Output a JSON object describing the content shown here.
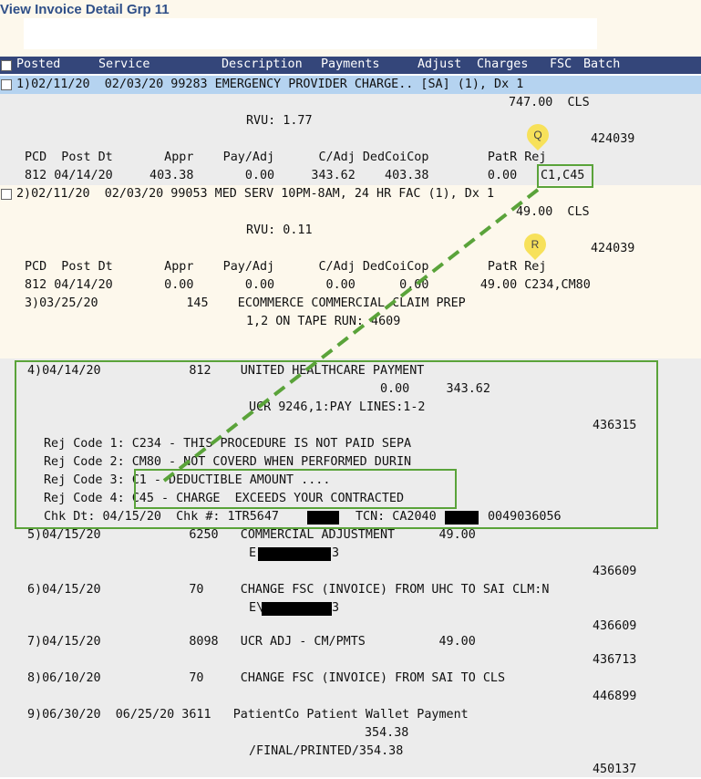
{
  "page": {
    "title": "View Invoice Detail Grp 11"
  },
  "header": {
    "posted": "Posted",
    "service": "Service",
    "description": "Description",
    "payments": "Payments",
    "adjust": "Adjust",
    "charges": "Charges",
    "fsc": "FSC",
    "batch": "Batch"
  },
  "rows": {
    "r1": {
      "line": "1)02/11/20  02/03/20 99283 EMERGENCY PROVIDER CHARGE.. [SA] (1), Dx 1",
      "charge": "747.00  CLS",
      "rvu": "RVU: 1.77",
      "batch": "424039",
      "sub_hdr": "PCD  Post Dt       Appr    Pay/Adj      C/Adj DedCoiCop        PatR Rej",
      "sub_line": "812 04/14/20     403.38       0.00     343.62    403.38        0.00 ",
      "rej": "C1,C45"
    },
    "r2": {
      "line": "2)02/11/20  02/03/20 99053 MED SERV 10PM-8AM, 24 HR FAC (1), Dx 1",
      "charge": "49.00  CLS",
      "rvu": "RVU: 0.11",
      "batch": "424039",
      "sub_hdr": "PCD  Post Dt       Appr    Pay/Adj      C/Adj DedCoiCop        PatR Rej",
      "sub_line": "812 04/14/20       0.00       0.00       0.00      0.00       49.00 C234,CM80"
    },
    "r3": {
      "line": "3)03/25/20            145    ECOMMERCE COMMERCIAL CLAIM PREP",
      "sub": "1,2 ON TAPE RUN: 4609"
    },
    "r4": {
      "line": "4)04/14/20            812    UNITED HEALTHCARE PAYMENT",
      "amounts": "0.00     343.62",
      "ucr": "UCR 9246,1:PAY LINES:1-2",
      "batch": "436315",
      "rej1": "Rej Code 1: C234 - THIS PROCEDURE IS NOT PAID SEPA",
      "rej2": "Rej Code 2: CM80 - NOT COVERD WHEN PERFORMED DURIN",
      "rej3": "Rej Code 3: C1 - DEDUCTIBLE AMOUNT ....",
      "rej4": "Rej Code 4: C45 - CHARGE  EXCEEDS YOUR CONTRACTED",
      "chk_a": "Chk Dt: 04/15/20  Chk #: 1TR5647",
      "chk_b": "TCN: CA2040",
      "chk_c": "0049036056"
    },
    "r5": {
      "line": "5)04/15/20            6250   COMMERCIAL ADJUSTMENT      49.00",
      "sub_a": "E",
      "sub_b": "3",
      "batch": "436609"
    },
    "r6": {
      "line": "6)04/15/20            70     CHANGE FSC (INVOICE) FROM UHC TO SAI CLM:N",
      "sub_a": "E\\",
      "sub_b": "3",
      "batch": "436609"
    },
    "r7": {
      "line": "7)04/15/20            8098   UCR ADJ - CM/PMTS          49.00",
      "batch": "436713"
    },
    "r8": {
      "line": "8)06/10/20            70     CHANGE FSC (INVOICE) FROM SAI TO CLS",
      "batch": "446899"
    },
    "r9": {
      "line": "9)06/30/20  06/25/20 3611   PatientCo Patient Wallet Payment",
      "amount": "354.38",
      "sub": "/FINAL/PRINTED/354.38",
      "batch": "450137"
    }
  },
  "markers": {
    "q": "Q",
    "r": "R"
  },
  "colors": {
    "header_bg": "#34467a",
    "row1_bg": "#b5d3f0",
    "band_cream": "#fdf8ec",
    "band_gray": "#ececec",
    "highlight": "#5aa33a",
    "marker": "#f7e15a",
    "title": "#2f4f88"
  }
}
